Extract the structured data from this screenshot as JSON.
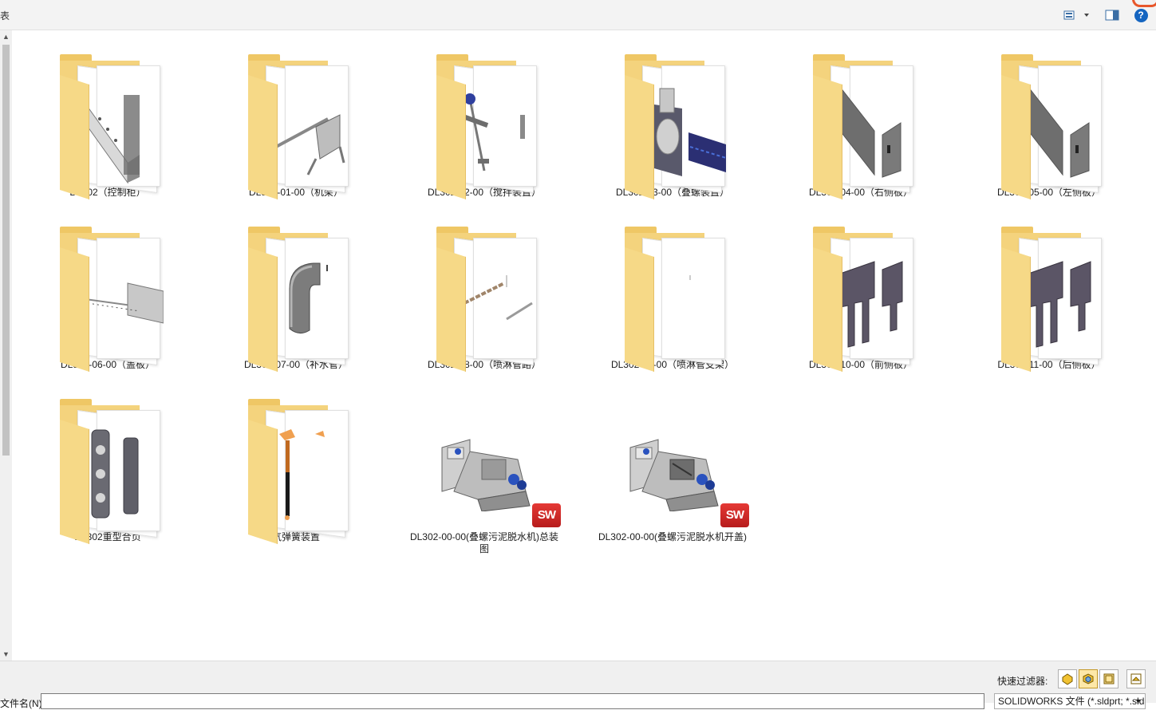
{
  "topbar": {
    "left_glyph": "表",
    "view_icon": "view-options-icon",
    "preview_icon": "preview-pane-icon",
    "help_label": "?"
  },
  "items": [
    {
      "name": "DL302（控制柜）",
      "kind": "folder"
    },
    {
      "name": "DL302-01-00（机架）",
      "kind": "folder"
    },
    {
      "name": "DL302-02-00（搅拌装置）",
      "kind": "folder"
    },
    {
      "name": "DL302-03-00（叠螺装置）",
      "kind": "folder"
    },
    {
      "name": "DL302-04-00（右侧板）",
      "kind": "folder"
    },
    {
      "name": "DL302-05-00（左侧板）",
      "kind": "folder"
    },
    {
      "name": "DL302-06-00（盖板）",
      "kind": "folder"
    },
    {
      "name": "DL302-07-00（补水管）",
      "kind": "folder"
    },
    {
      "name": "DL302-08-00（喷淋管路）",
      "kind": "folder"
    },
    {
      "name": "DL302-09-00（喷淋管支架）",
      "kind": "folder"
    },
    {
      "name": "DL302-10-00（前侧板）",
      "kind": "folder"
    },
    {
      "name": "DL302-11-00（后侧板）",
      "kind": "folder"
    },
    {
      "name": "DL302重型合页",
      "kind": "folder"
    },
    {
      "name": "气弹簧装置",
      "kind": "folder"
    },
    {
      "name": "DL302-00-00(叠螺污泥脱水机)总装图",
      "kind": "assembly"
    },
    {
      "name": "DL302-00-00(叠螺污泥脱水机开盖)",
      "kind": "assembly"
    }
  ],
  "sw_badge": "SW",
  "bottom": {
    "quick_filter_label": "快速过滤器:",
    "filename_label": "文件名(N):",
    "filename_value": "",
    "filetype_value": "SOLIDWORKS 文件 (*.sldprt; *.sldasm; *.slddrw)"
  },
  "colors": {
    "folder_back": "#f4d37d",
    "folder_front": "#f6d987",
    "help_blue": "#1565c0",
    "sw_red": "#d32f2f",
    "filter_active": "#fde8a8"
  }
}
